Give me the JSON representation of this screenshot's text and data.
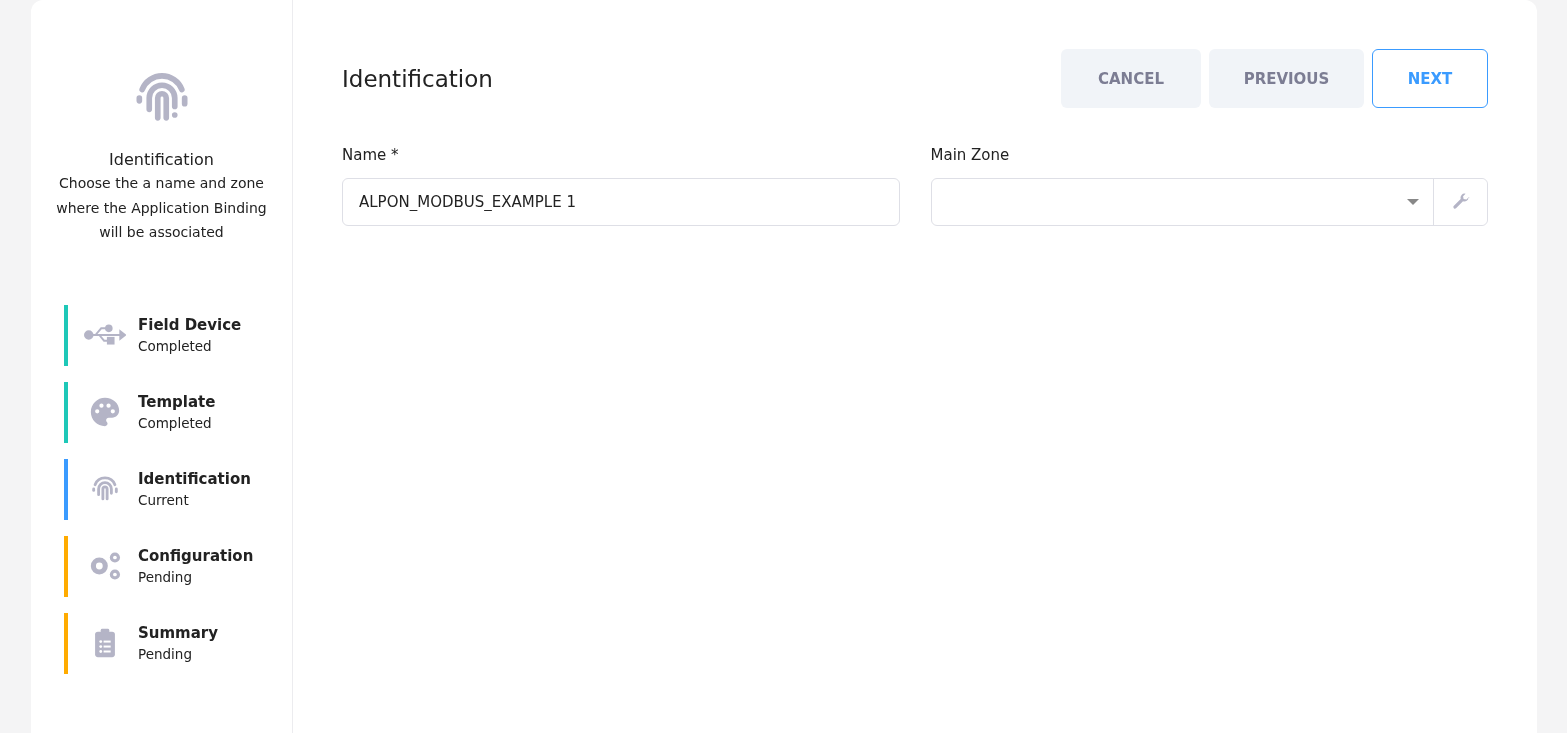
{
  "sidebar": {
    "title": "Identification",
    "description": "Choose the a name and zone where the Application Binding will be associated",
    "steps": [
      {
        "label": "Field Device",
        "status": "Completed",
        "kind": "completed"
      },
      {
        "label": "Template",
        "status": "Completed",
        "kind": "completed"
      },
      {
        "label": "Identification",
        "status": "Current",
        "kind": "current"
      },
      {
        "label": "Configuration",
        "status": "Pending",
        "kind": "pending"
      },
      {
        "label": "Summary",
        "status": "Pending",
        "kind": "pending"
      }
    ]
  },
  "main": {
    "title": "Identification",
    "buttons": [
      {
        "label": "CANCEL",
        "kind": "secondary"
      },
      {
        "label": "PREVIOUS",
        "kind": "secondary"
      },
      {
        "label": "NEXT",
        "kind": "primary"
      }
    ],
    "name_field": {
      "label": "Name *",
      "value": "ALPON_MODBUS_EXAMPLE 1"
    },
    "zone_field": {
      "label": "Main Zone"
    }
  }
}
